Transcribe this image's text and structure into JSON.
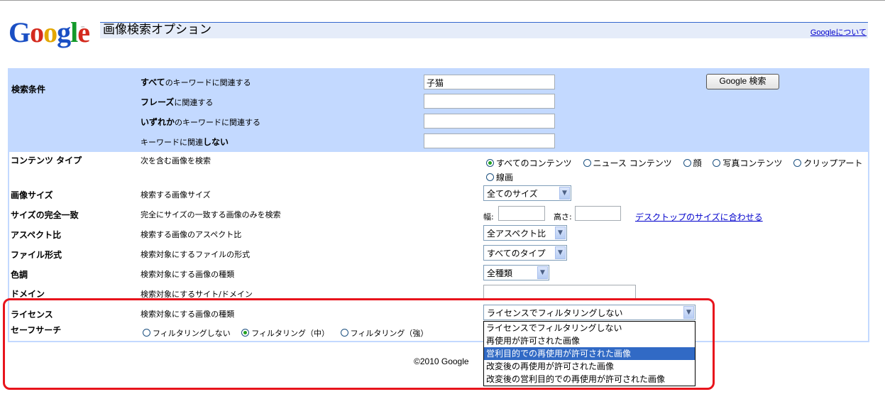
{
  "header": {
    "logo": "Google",
    "page_title": "画像検索オプション",
    "about_link": "Googleについて"
  },
  "search_conditions": {
    "section_label": "検索条件",
    "rows": [
      {
        "strong": "すべて",
        "rest": "のキーワードに関連する",
        "value": "子猫"
      },
      {
        "strong": "フレーズ",
        "rest": "に関連する",
        "value": ""
      },
      {
        "strong": "いずれか",
        "rest": "のキーワードに関連する",
        "value": ""
      },
      {
        "pre": "キーワードに関連",
        "strong": "しない",
        "value": ""
      }
    ],
    "search_button": "Google 検索"
  },
  "options": {
    "content_type": {
      "label": "コンテンツ タイプ",
      "desc": "次を含む画像を検索",
      "choices": [
        "すべてのコンテンツ",
        "ニュース コンテンツ",
        "顔",
        "写真コンテンツ",
        "クリップアート",
        "線画"
      ],
      "selected": "すべてのコンテンツ"
    },
    "image_size": {
      "label": "画像サイズ",
      "desc": "検索する画像サイズ",
      "value": "全てのサイズ"
    },
    "exact_size": {
      "label": "サイズの完全一致",
      "desc": "完全にサイズの一致する画像のみを検索",
      "width_label": "幅:",
      "height_label": "高さ:",
      "link": "デスクトップのサイズに合わせる"
    },
    "aspect_ratio": {
      "label": "アスペクト比",
      "desc": "検索する画像のアスペクト比",
      "value": "全アスペクト比"
    },
    "file_type": {
      "label": "ファイル形式",
      "desc": "検索対象にするファイルの形式",
      "value": "すべてのタイプ"
    },
    "coloration": {
      "label": "色調",
      "desc": "検索対象にする画像の種類",
      "value": "全種類"
    },
    "domain": {
      "label": "ドメイン",
      "desc": "検索対象にするサイト/ドメイン",
      "value": ""
    },
    "license": {
      "label": "ライセンス",
      "desc": "検索対象にする画像の種類",
      "value": "ライセンスでフィルタリングしない",
      "dropdown_options": [
        "ライセンスでフィルタリングしない",
        "再使用が許可された画像",
        "営利目的での再使用が許可された画像",
        "改変後の再使用が許可された画像",
        "改変後の営利目的での再使用が許可された画像"
      ],
      "highlighted": "営利目的での再使用が許可された画像"
    },
    "safesearch": {
      "label": "セーフサーチ",
      "choices": [
        "フィルタリングしない",
        "フィルタリング（中）",
        "フィルタリング（強）"
      ],
      "selected": "フィルタリング（中）"
    }
  },
  "footer": {
    "copyright": "©2010 Google"
  },
  "colors": {
    "panel": "#c3d9ff",
    "title_bar": "#e5ecf9",
    "highlight": "#316ac5",
    "annotation": "#e8141c"
  }
}
